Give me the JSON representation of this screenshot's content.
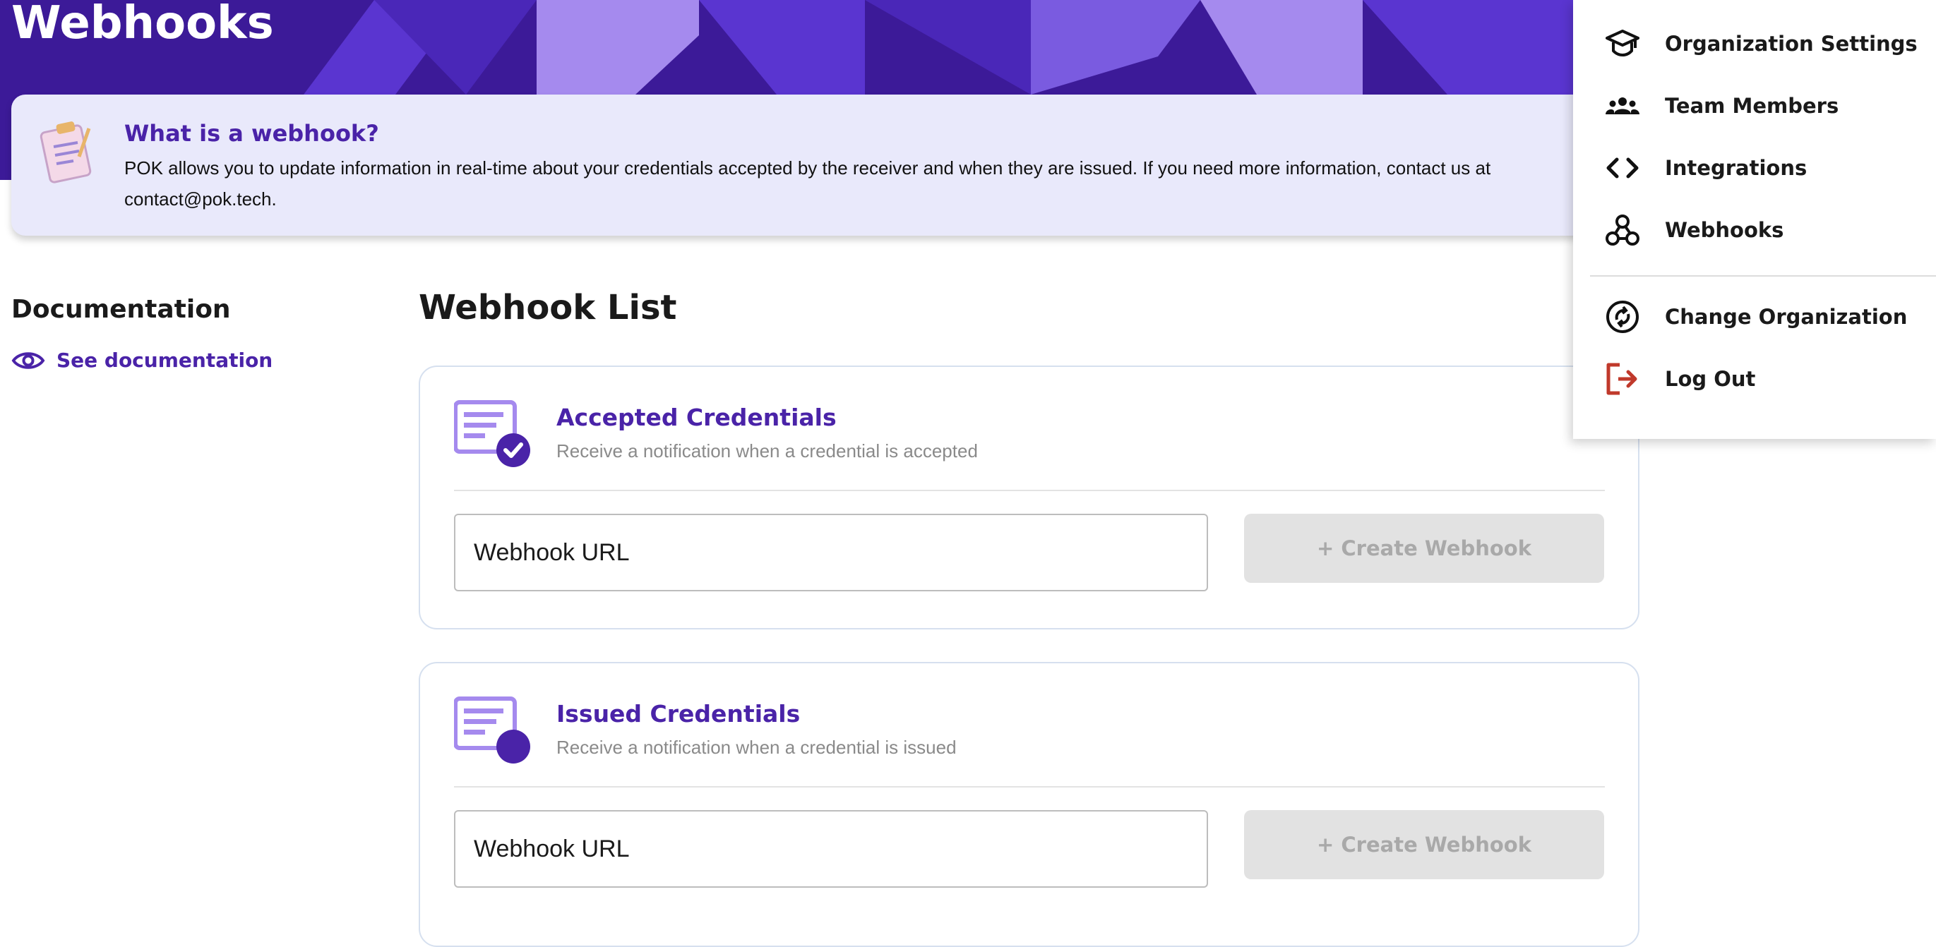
{
  "header": {
    "title": "Webhooks"
  },
  "info": {
    "heading": "What is a webhook?",
    "text": "POK allows you to update information in real-time about your credentials accepted by the receiver and when they are issued. If you need more information, contact us at contact@pok.tech."
  },
  "documentation": {
    "heading": "Documentation",
    "link_label": "See documentation",
    "link_icon": "eye-icon"
  },
  "webhook_list": {
    "heading": "Webhook List",
    "cards": [
      {
        "title": "Accepted Credentials",
        "subtitle": "Receive a notification when a credential is accepted",
        "icon": "credential-accepted-icon",
        "url_value": "Webhook URL",
        "button_label": "+ Create Webhook"
      },
      {
        "title": "Issued Credentials",
        "subtitle": "Receive a notification when a credential is issued",
        "icon": "credential-issued-icon",
        "url_value": "Webhook URL",
        "button_label": "+ Create Webhook"
      }
    ]
  },
  "menu": {
    "items": [
      {
        "label": "Organization Settings",
        "icon": "graduation-cap-icon"
      },
      {
        "label": "Team Members",
        "icon": "team-icon"
      },
      {
        "label": "Integrations",
        "icon": "code-icon"
      },
      {
        "label": "Webhooks",
        "icon": "webhook-icon"
      },
      {
        "label": "Change Organization",
        "icon": "switch-icon"
      },
      {
        "label": "Log Out",
        "icon": "logout-icon"
      }
    ]
  },
  "colors": {
    "brand_purple": "#4a23a8",
    "banner": "#3c1a98",
    "info_bg": "#e9e9fb",
    "button_disabled_bg": "#e2e2e2",
    "logout_red": "#c0392b"
  }
}
